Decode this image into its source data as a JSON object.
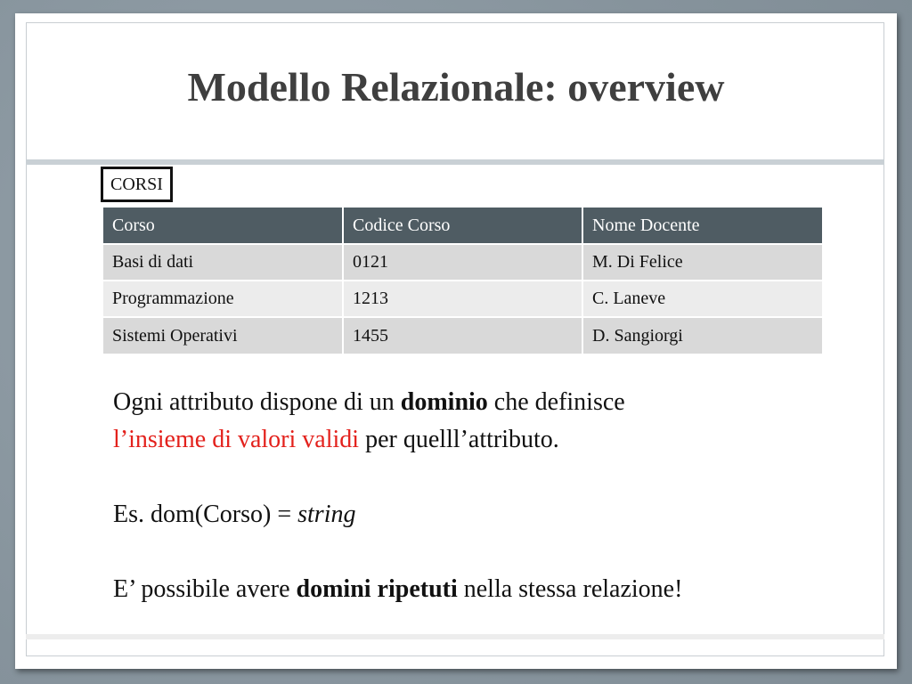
{
  "slide": {
    "title": "Modello Relazionale: overview",
    "table_caption": "CORSI",
    "table": {
      "headers": [
        "Corso",
        "Codice Corso",
        "Nome Docente"
      ],
      "rows": [
        [
          "Basi di dati",
          "0121",
          "M. Di Felice"
        ],
        [
          "Programmazione",
          "1213",
          "C. Laneve"
        ],
        [
          "Sistemi Operativi",
          "1455",
          "D. Sangiorgi"
        ]
      ]
    },
    "paragraph1": {
      "part1": "Ogni attributo dispone di un ",
      "bold": "dominio",
      "part2": " che definisce",
      "red": "l’insieme di valori validi",
      "part3": " per quelll’attributo."
    },
    "paragraph2": {
      "prefix": "Es.  dom(Corso) = ",
      "italic": "string"
    },
    "paragraph3": {
      "part1": "E’ possibile avere ",
      "bold": "domini ripetuti",
      "part2": " nella stessa relazione!"
    }
  },
  "colors": {
    "header_bg": "#4f5c63",
    "row_bg": "#d9d9d9",
    "row_alt_bg": "#ececec",
    "highlight_red": "#e3211c",
    "title": "#3f3f3f"
  }
}
